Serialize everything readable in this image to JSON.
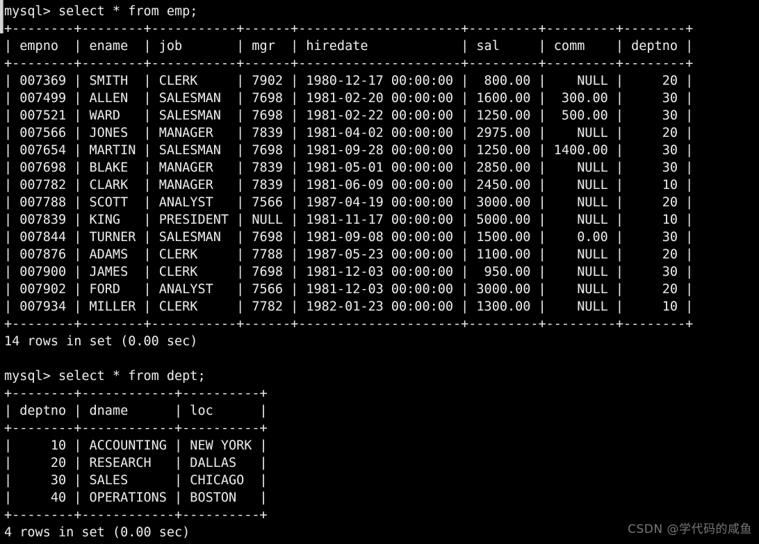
{
  "terminal": {
    "prompt": "mysql> ",
    "title": "mysql client session",
    "background_color": "#000000",
    "text_color": "#e9e9e9",
    "watermark": "CSDN @学代码的咸鱼"
  },
  "commands": [
    {
      "prompt": "mysql> ",
      "text": "select * from emp;"
    },
    {
      "prompt": "mysql> ",
      "text": "select * from dept;"
    }
  ],
  "results": [
    {
      "table": "emp",
      "status": "14 rows in set (0.00 sec)",
      "columns": [
        {
          "name": "empno",
          "width": 8,
          "align": "right"
        },
        {
          "name": "ename",
          "width": 8,
          "align": "left"
        },
        {
          "name": "job",
          "width": 11,
          "align": "left"
        },
        {
          "name": "mgr",
          "width": 6,
          "align": "right"
        },
        {
          "name": "hiredate",
          "width": 21,
          "align": "left"
        },
        {
          "name": "sal",
          "width": 9,
          "align": "right"
        },
        {
          "name": "comm",
          "width": 9,
          "align": "right"
        },
        {
          "name": "deptno",
          "width": 8,
          "align": "right"
        }
      ],
      "rows": [
        [
          "007369",
          "SMITH",
          "CLERK",
          "7902",
          "1980-12-17 00:00:00",
          "800.00",
          "NULL",
          "20"
        ],
        [
          "007499",
          "ALLEN",
          "SALESMAN",
          "7698",
          "1981-02-20 00:00:00",
          "1600.00",
          "300.00",
          "30"
        ],
        [
          "007521",
          "WARD",
          "SALESMAN",
          "7698",
          "1981-02-22 00:00:00",
          "1250.00",
          "500.00",
          "30"
        ],
        [
          "007566",
          "JONES",
          "MANAGER",
          "7839",
          "1981-04-02 00:00:00",
          "2975.00",
          "NULL",
          "20"
        ],
        [
          "007654",
          "MARTIN",
          "SALESMAN",
          "7698",
          "1981-09-28 00:00:00",
          "1250.00",
          "1400.00",
          "30"
        ],
        [
          "007698",
          "BLAKE",
          "MANAGER",
          "7839",
          "1981-05-01 00:00:00",
          "2850.00",
          "NULL",
          "30"
        ],
        [
          "007782",
          "CLARK",
          "MANAGER",
          "7839",
          "1981-06-09 00:00:00",
          "2450.00",
          "NULL",
          "10"
        ],
        [
          "007788",
          "SCOTT",
          "ANALYST",
          "7566",
          "1987-04-19 00:00:00",
          "3000.00",
          "NULL",
          "20"
        ],
        [
          "007839",
          "KING",
          "PRESIDENT",
          "NULL",
          "1981-11-17 00:00:00",
          "5000.00",
          "NULL",
          "10"
        ],
        [
          "007844",
          "TURNER",
          "SALESMAN",
          "7698",
          "1981-09-08 00:00:00",
          "1500.00",
          "0.00",
          "30"
        ],
        [
          "007876",
          "ADAMS",
          "CLERK",
          "7788",
          "1987-05-23 00:00:00",
          "1100.00",
          "NULL",
          "20"
        ],
        [
          "007900",
          "JAMES",
          "CLERK",
          "7698",
          "1981-12-03 00:00:00",
          "950.00",
          "NULL",
          "30"
        ],
        [
          "007902",
          "FORD",
          "ANALYST",
          "7566",
          "1981-12-03 00:00:00",
          "3000.00",
          "NULL",
          "20"
        ],
        [
          "007934",
          "MILLER",
          "CLERK",
          "7782",
          "1982-01-23 00:00:00",
          "1300.00",
          "NULL",
          "10"
        ]
      ]
    },
    {
      "table": "dept",
      "status": "4 rows in set (0.00 sec)",
      "columns": [
        {
          "name": "deptno",
          "width": 8,
          "align": "right"
        },
        {
          "name": "dname",
          "width": 12,
          "align": "left"
        },
        {
          "name": "loc",
          "width": 10,
          "align": "left"
        }
      ],
      "rows": [
        [
          "10",
          "ACCOUNTING",
          "NEW YORK"
        ],
        [
          "20",
          "RESEARCH",
          "DALLAS"
        ],
        [
          "30",
          "SALES",
          "CHICAGO"
        ],
        [
          "40",
          "OPERATIONS",
          "BOSTON"
        ]
      ]
    }
  ]
}
